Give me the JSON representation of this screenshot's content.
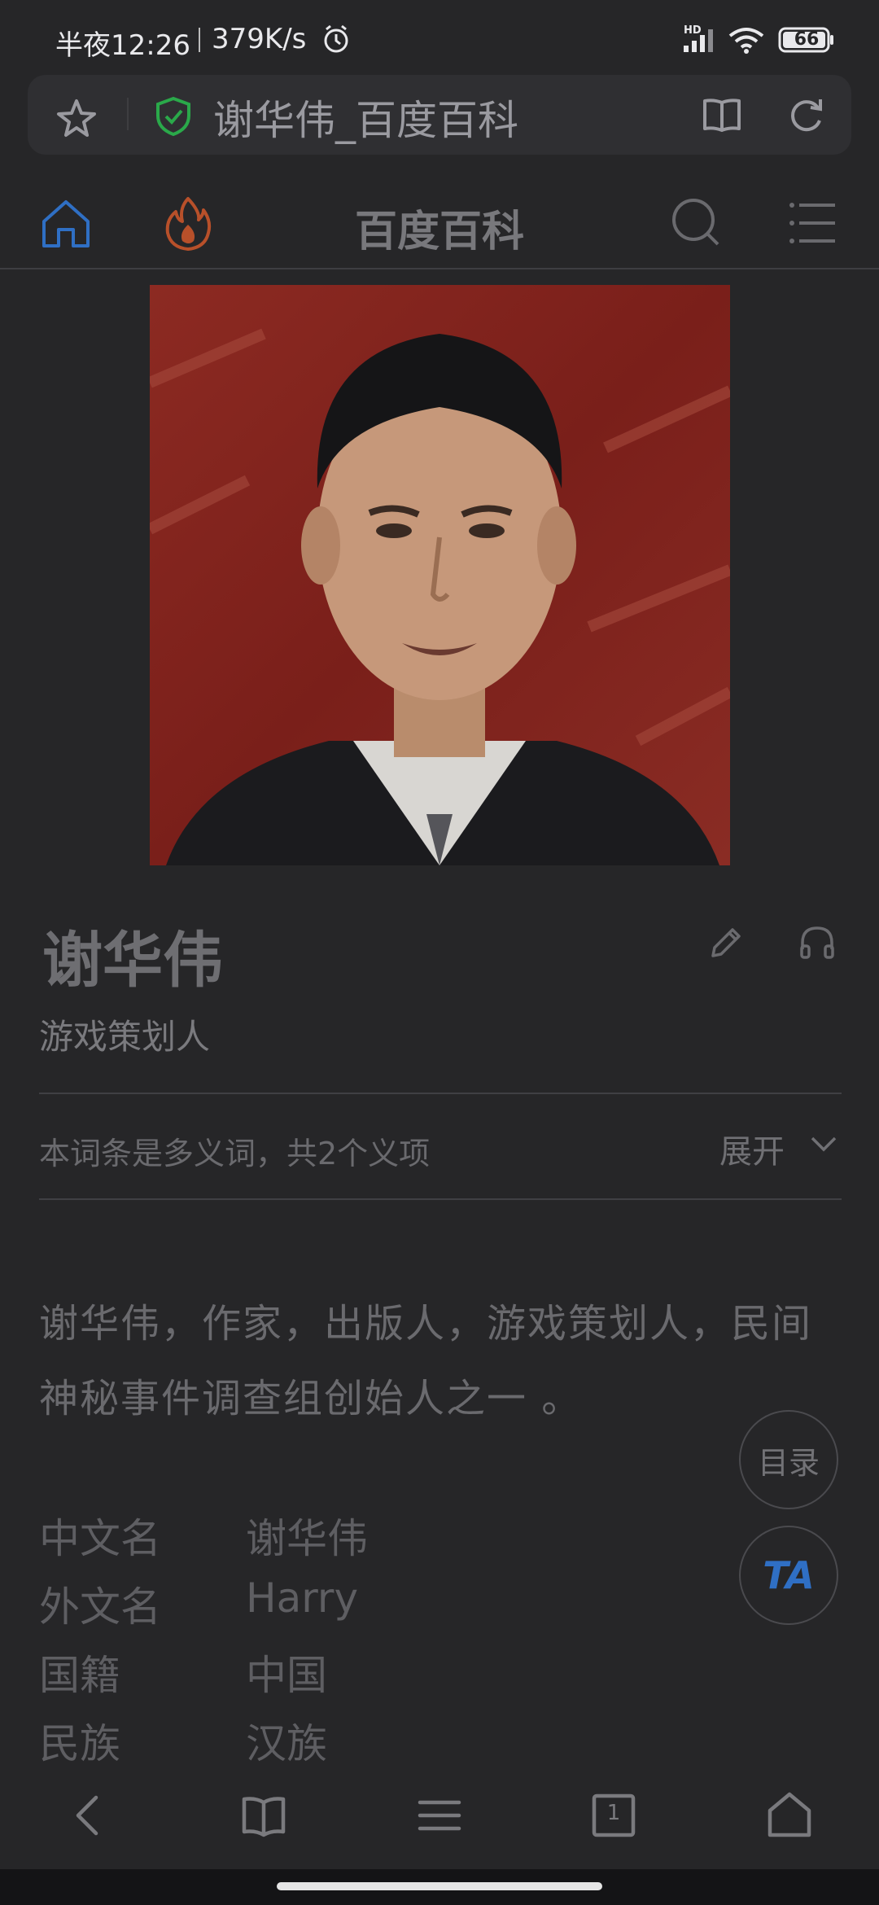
{
  "status_bar": {
    "time": "半夜12:26",
    "speed": "379K/s",
    "network_label": "HD",
    "battery": "66"
  },
  "address_bar": {
    "title": "谢华伟_百度百科"
  },
  "site_header": {
    "title": "百度百科"
  },
  "entry": {
    "title": "谢华伟",
    "subtitle": "游戏策划人",
    "polysemy_note": "本词条是多义词，共2个义项",
    "expand_label": "展开",
    "summary": "谢华伟，作家，出版人，游戏策划人，民间神秘事件调查组创始人之一 。",
    "info": [
      {
        "key": "中文名",
        "value": "谢华伟"
      },
      {
        "key": "外文名",
        "value": "Harry"
      },
      {
        "key": "国籍",
        "value": "中国"
      },
      {
        "key": "民族",
        "value": "汉族"
      }
    ]
  },
  "floating": {
    "toc_label": "目录",
    "ta_label": "TA"
  },
  "bottom_nav": {
    "tab_count": "1"
  },
  "colors": {
    "accent_blue": "#2f6fc4",
    "fire_orange": "#b8502a",
    "shield_green": "#2aa94a",
    "background": "#262628"
  }
}
